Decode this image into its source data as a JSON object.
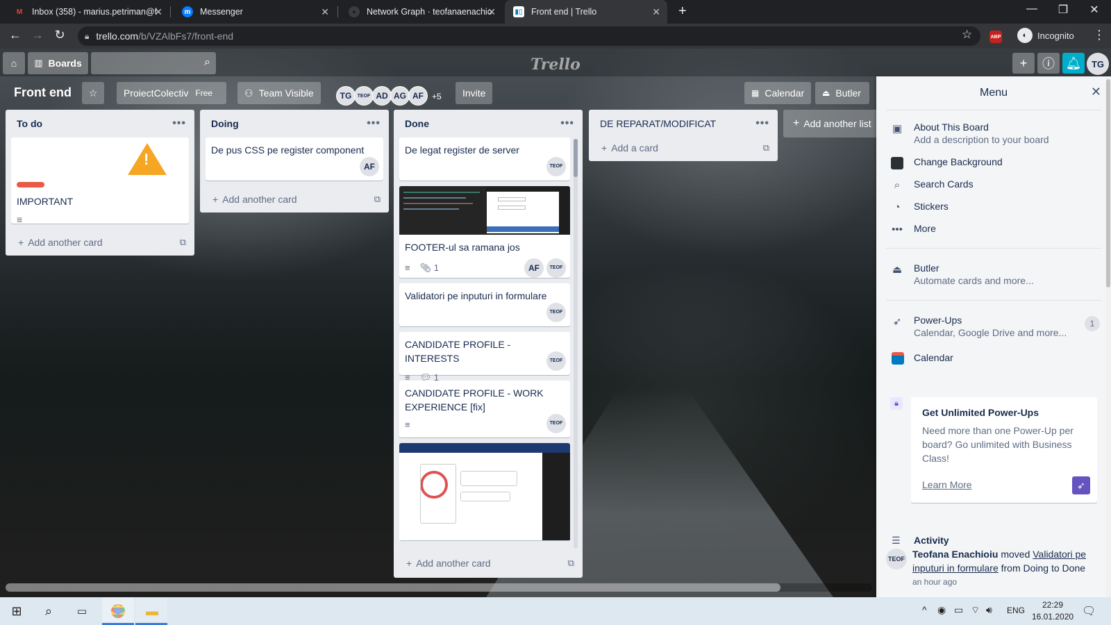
{
  "browser": {
    "tabs": [
      {
        "title": "Inbox (358) - marius.petriman@f",
        "icon": "gmail-icon"
      },
      {
        "title": "Messenger",
        "icon": "messenger-icon"
      },
      {
        "title": "Network Graph · teofanaenachiou",
        "icon": "github-icon"
      },
      {
        "title": "Front end | Trello",
        "icon": "trello-icon"
      }
    ],
    "url_host": "trello.com",
    "url_path": "/b/VZAlbFs7/front-end",
    "incognito_label": "Incognito",
    "abp_label": "ABP"
  },
  "trello_header": {
    "boards_label": "Boards",
    "logo": "Trello",
    "avatar": "TG"
  },
  "board": {
    "name": "Front end",
    "team_name": "ProiectColectiv",
    "team_plan": "Free",
    "visibility": "Team Visible",
    "members": [
      "TG",
      "TEOF",
      "AD",
      "AG",
      "AF"
    ],
    "more_members": "+5",
    "invite_label": "Invite",
    "calendar_label": "Calendar",
    "butler_label": "Butler",
    "add_list_label": "Add another list"
  },
  "lists": [
    {
      "title": "To do",
      "cards": [
        {
          "title": "IMPORTANT",
          "label": "red",
          "has_description": true,
          "sticker": "warning"
        }
      ],
      "add_label": "Add another card"
    },
    {
      "title": "Doing",
      "cards": [
        {
          "title": "De pus CSS pe register component",
          "members": [
            "AF"
          ]
        }
      ],
      "add_label": "Add another card"
    },
    {
      "title": "Done",
      "cards": [
        {
          "title": "De legat register de server",
          "members": [
            "TEOF"
          ]
        },
        {
          "title": "FOOTER-ul sa ramana jos",
          "attachments": "1",
          "members": [
            "AF",
            "TEOF"
          ],
          "cover": "screenshot"
        },
        {
          "title": "Validatori pe inputuri in formulare",
          "members": [
            "TEOF"
          ]
        },
        {
          "title": "CANDIDATE PROFILE - INTERESTS",
          "comments": "1",
          "members": [
            "TEOF"
          ]
        },
        {
          "title": "CANDIDATE PROFILE - WORK EXPERIENCE [fix]",
          "members": [
            "TEOF"
          ]
        }
      ],
      "add_label": "Add another card"
    },
    {
      "title": "DE REPARAT/MODIFICAT",
      "cards": [],
      "add_label": "Add a card"
    }
  ],
  "menu": {
    "title": "Menu",
    "items": [
      {
        "title": "About This Board",
        "subtitle": "Add a description to your board",
        "icon": "board-icon"
      },
      {
        "title": "Change Background",
        "icon": "background-icon"
      },
      {
        "title": "Search Cards",
        "icon": "search-icon"
      },
      {
        "title": "Stickers",
        "icon": "sticker-icon"
      },
      {
        "title": "More",
        "icon": "ellipsis-icon"
      }
    ],
    "butler": {
      "title": "Butler",
      "subtitle": "Automate cards and more..."
    },
    "powerups": {
      "title": "Power-Ups",
      "subtitle": "Calendar, Google Drive and more...",
      "count": "1"
    },
    "calendar": "Calendar",
    "promo": {
      "title": "Get Unlimited Power-Ups",
      "body": "Need more than one Power-Up per board? Go unlimited with Business Class!",
      "link": "Learn More"
    },
    "activity": {
      "title": "Activity",
      "avatar": "TEOF",
      "user": "Teofana Enachioiu",
      "verb": "moved",
      "card": "Validatori pe inputuri in formulare",
      "rest": "from Doing to Done",
      "when": "an hour ago"
    }
  },
  "taskbar": {
    "lang": "ENG",
    "time": "22:29",
    "date": "16.01.2020"
  }
}
